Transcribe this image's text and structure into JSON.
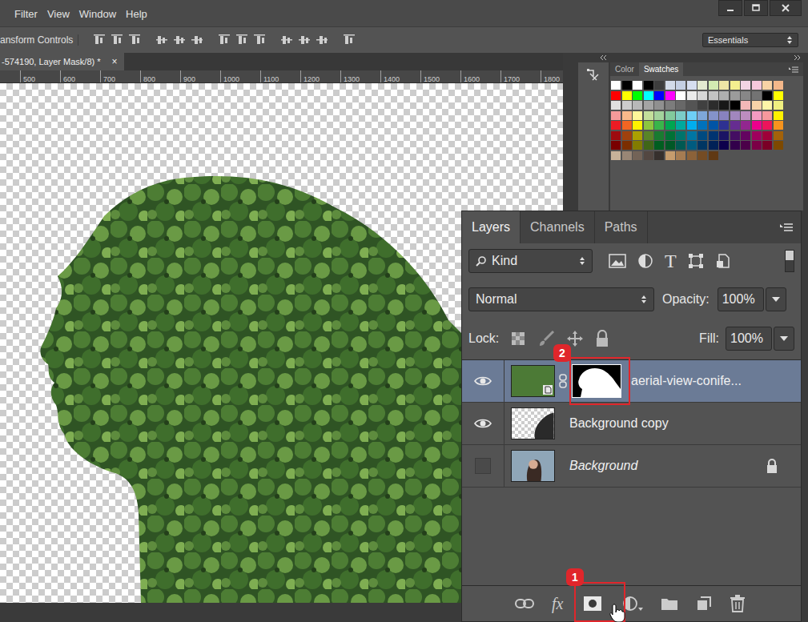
{
  "menu": [
    "Filter",
    "View",
    "Window",
    "Help"
  ],
  "options_bar": {
    "label": "ansform Controls",
    "workspace": "Essentials"
  },
  "document_tab": {
    "title": "-574190, Layer Mask/8) *",
    "close": "×"
  },
  "ruler": [
    "500",
    "600",
    "700",
    "800",
    "900",
    "1000",
    "1100",
    "1200",
    "1300",
    "1400",
    "1500",
    "1600",
    "1700",
    "1800"
  ],
  "swatches_panel": {
    "tabs": [
      {
        "label": "Color",
        "selected": false
      },
      {
        "label": "Swatches",
        "selected": true
      }
    ],
    "swatches": [
      {
        "color": "#ffffff"
      },
      {
        "color": "#000000"
      },
      {
        "color": "#ffffff"
      },
      {
        "color": "#000000"
      },
      {
        "color": "#3d3d3d"
      },
      {
        "color": "#d3dbe9"
      },
      {
        "color": "#c4cfe3"
      },
      {
        "color": "#d6def0"
      },
      {
        "color": "#e4ead1"
      },
      {
        "color": "#d2ecb2"
      },
      {
        "color": "#eee5a6"
      },
      {
        "color": "#f4ef8f"
      },
      {
        "color": "#f2d4e4"
      },
      {
        "color": "#f7c9dc"
      },
      {
        "color": "#f8d3a5"
      },
      {
        "color": "#f4b88a"
      },
      {
        "color": "#ff0000"
      },
      {
        "color": "#ffff00"
      },
      {
        "color": "#00ff00"
      },
      {
        "color": "#00ffff"
      },
      {
        "color": "#0000ff"
      },
      {
        "color": "#ff00ff"
      },
      {
        "color": "#ffffff"
      },
      {
        "color": "#ebebeb"
      },
      {
        "color": "#d7d7d7"
      },
      {
        "color": "#c3c3c3"
      },
      {
        "color": "#afafaf"
      },
      {
        "color": "#9b9b9b"
      },
      {
        "color": "#878787"
      },
      {
        "color": "#737373"
      },
      {
        "color": "#000000"
      },
      {
        "color": "#ffff00"
      },
      {
        "color": "#e0e0e0"
      },
      {
        "color": "#cccccc"
      },
      {
        "color": "#b8b8b8"
      },
      {
        "color": "#a4a4a4"
      },
      {
        "color": "#909090"
      },
      {
        "color": "#7c7c7c"
      },
      {
        "color": "#686868"
      },
      {
        "color": "#545454"
      },
      {
        "color": "#404040"
      },
      {
        "color": "#2c2c2c"
      },
      {
        "color": "#181818"
      },
      {
        "color": "#000000"
      },
      {
        "color": "#f2b8b8"
      },
      {
        "color": "#f8d2a8"
      },
      {
        "color": "#fff6a8"
      },
      {
        "color": "#f0f080"
      },
      {
        "color": "#f49a9a"
      },
      {
        "color": "#f9b98a"
      },
      {
        "color": "#fff799"
      },
      {
        "color": "#c4df9b"
      },
      {
        "color": "#a3d39c"
      },
      {
        "color": "#82ca9d"
      },
      {
        "color": "#7bcdc8"
      },
      {
        "color": "#6ecff6"
      },
      {
        "color": "#7ea7d8"
      },
      {
        "color": "#8493ca"
      },
      {
        "color": "#8882be"
      },
      {
        "color": "#a187be"
      },
      {
        "color": "#bc8dbf"
      },
      {
        "color": "#f49ac2"
      },
      {
        "color": "#f6989d"
      },
      {
        "color": "#fff200"
      },
      {
        "color": "#ed1c24"
      },
      {
        "color": "#f26522"
      },
      {
        "color": "#fff200"
      },
      {
        "color": "#8dc63f"
      },
      {
        "color": "#39b54a"
      },
      {
        "color": "#00a651"
      },
      {
        "color": "#00a99d"
      },
      {
        "color": "#00aeef"
      },
      {
        "color": "#0072bc"
      },
      {
        "color": "#0054a6"
      },
      {
        "color": "#2e3192"
      },
      {
        "color": "#662d91"
      },
      {
        "color": "#92278f"
      },
      {
        "color": "#ec008c"
      },
      {
        "color": "#ed145b"
      },
      {
        "color": "#f7941d"
      },
      {
        "color": "#9e0b0f"
      },
      {
        "color": "#a0410d"
      },
      {
        "color": "#aba000"
      },
      {
        "color": "#598527"
      },
      {
        "color": "#197b30"
      },
      {
        "color": "#007236"
      },
      {
        "color": "#00746b"
      },
      {
        "color": "#0076a3"
      },
      {
        "color": "#004a80"
      },
      {
        "color": "#003471"
      },
      {
        "color": "#1b1464"
      },
      {
        "color": "#440e62"
      },
      {
        "color": "#630460"
      },
      {
        "color": "#9e005d"
      },
      {
        "color": "#9e0039"
      },
      {
        "color": "#a36209"
      },
      {
        "color": "#790000"
      },
      {
        "color": "#7b2e00"
      },
      {
        "color": "#827b00"
      },
      {
        "color": "#406618"
      },
      {
        "color": "#005e20"
      },
      {
        "color": "#005826"
      },
      {
        "color": "#005952"
      },
      {
        "color": "#005b7f"
      },
      {
        "color": "#003663"
      },
      {
        "color": "#002157"
      },
      {
        "color": "#0d004c"
      },
      {
        "color": "#32004b"
      },
      {
        "color": "#4b0049"
      },
      {
        "color": "#7b0046"
      },
      {
        "color": "#7a0026"
      },
      {
        "color": "#7d4900"
      },
      {
        "color": "#c7b299"
      },
      {
        "color": "#998675"
      },
      {
        "color": "#736357"
      },
      {
        "color": "#534741"
      },
      {
        "color": "#37302d"
      },
      {
        "color": "#c69c6d"
      },
      {
        "color": "#a67c52"
      },
      {
        "color": "#8c6239"
      },
      {
        "color": "#754c24"
      },
      {
        "color": "#603913"
      }
    ]
  },
  "layers_panel": {
    "tabs": [
      {
        "label": "Layers",
        "selected": true
      },
      {
        "label": "Channels",
        "selected": false
      },
      {
        "label": "Paths",
        "selected": false
      }
    ],
    "filter": {
      "label": "Kind",
      "type_icon": "T",
      "enabled": true
    },
    "blend_mode": "Normal",
    "opacity": {
      "label": "Opacity:",
      "value": "100%"
    },
    "lock": {
      "label": "Lock:"
    },
    "fill": {
      "label": "Fill:",
      "value": "100%"
    },
    "layers": [
      {
        "name": "aerial-view-conife...",
        "kind": "smart-object",
        "visible": true,
        "selected": true,
        "locked": false,
        "has_mask": true
      },
      {
        "name": "Background copy",
        "kind": "cutout",
        "visible": true,
        "selected": false,
        "locked": false,
        "has_mask": false
      },
      {
        "name": "Background",
        "kind": "photo",
        "visible": false,
        "selected": false,
        "locked": true,
        "has_mask": false
      }
    ],
    "bottom_bar": {
      "fx": "fx"
    }
  },
  "callouts": [
    {
      "number": "1"
    },
    {
      "number": "2"
    }
  ]
}
